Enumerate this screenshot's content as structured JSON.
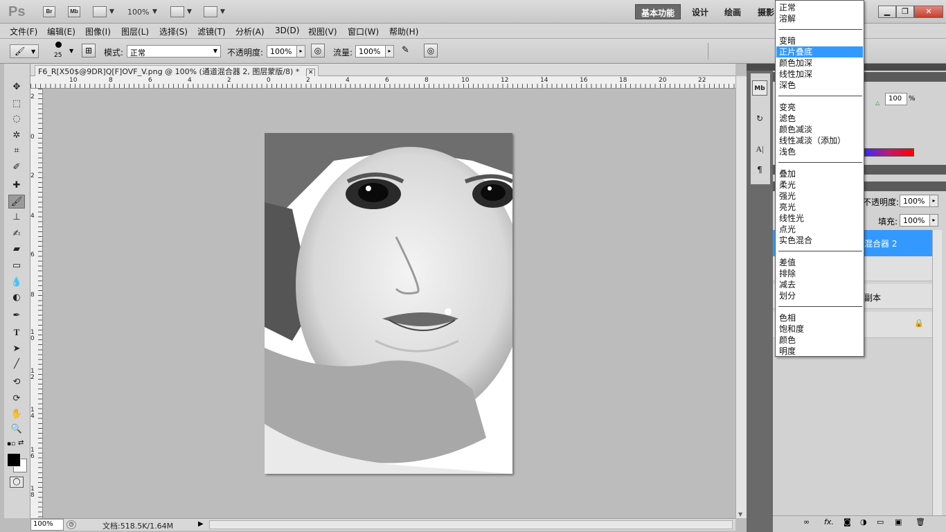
{
  "appbar": {
    "logo": "Ps",
    "bridge": "Br",
    "minibridge": "Mb",
    "zoom": "100%",
    "workspaces": [
      "基本功能",
      "设计",
      "绘画",
      "摄影"
    ],
    "window": {
      "minimize": "▁",
      "restore": "❐",
      "close": "✕"
    }
  },
  "menu": [
    "文件(F)",
    "编辑(E)",
    "图像(I)",
    "图层(L)",
    "选择(S)",
    "滤镜(T)",
    "分析(A)",
    "3D(D)",
    "视图(V)",
    "窗口(W)",
    "帮助(H)"
  ],
  "options": {
    "brush_size": "25",
    "mode_label": "模式:",
    "mode_value": "正常",
    "opacity_label": "不透明度:",
    "opacity_value": "100%",
    "flow_label": "流量:",
    "flow_value": "100%"
  },
  "document": {
    "tab_title": "F6_R[X50$@9DR]Q[F]OVF_V.png @ 100% (通道混合器 2, 图层蒙版/8) *",
    "close": "✕"
  },
  "ruler_top": [
    "10",
    "8",
    "6",
    "4",
    "2",
    "0",
    "2",
    "4",
    "6",
    "8",
    "10",
    "12",
    "14",
    "16",
    "18",
    "20",
    "22"
  ],
  "ruler_left": [
    "2",
    "0",
    "2",
    "4",
    "6",
    "8",
    "1\n0",
    "1\n2",
    "1\n4",
    "1\n6",
    "1\n8"
  ],
  "status": {
    "zoom": "100%",
    "doc_size": "文档:518.5K/1.64M"
  },
  "right_panel": {
    "slider_value": "100",
    "slider_unit": "%",
    "layers_opacity_label": "不透明度:",
    "layers_opacity_value": "100%",
    "fill_label": "填充:",
    "fill_value": "100%",
    "layer_selected": "混合器 2",
    "layer_copy": "副本"
  },
  "blend_modes": {
    "group1": [
      "正常",
      "溶解"
    ],
    "group2": [
      "变暗",
      "正片叠底",
      "颜色加深",
      "线性加深",
      "深色"
    ],
    "group3": [
      "变亮",
      "滤色",
      "颜色减淡",
      "线性减淡（添加）",
      "浅色"
    ],
    "group4": [
      "叠加",
      "柔光",
      "强光",
      "亮光",
      "线性光",
      "点光",
      "实色混合"
    ],
    "group5": [
      "差值",
      "排除",
      "减去",
      "划分"
    ],
    "group6": [
      "色相",
      "饱和度",
      "颜色",
      "明度"
    ],
    "selected": "正片叠底"
  },
  "colors": {
    "selection": "#3399ff",
    "layer_selected_bg": "#3399ff",
    "foreground": "#000000",
    "background": "#ffffff"
  }
}
